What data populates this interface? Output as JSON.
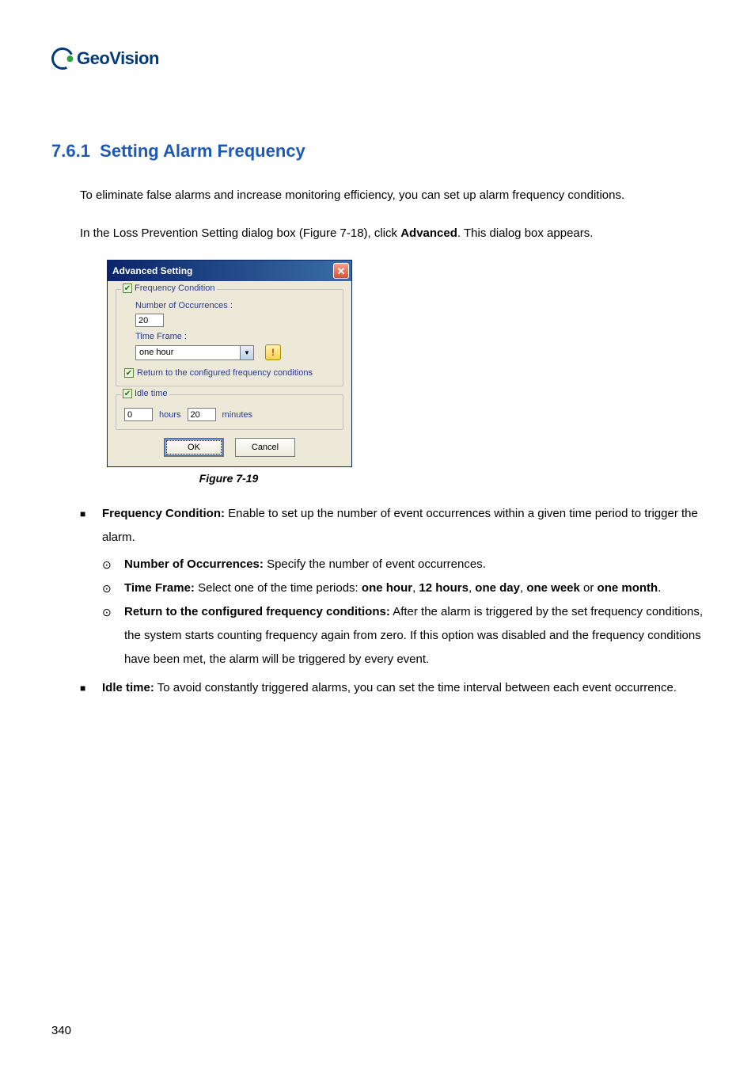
{
  "logo": {
    "brand": "GeoVision",
    "sub": ""
  },
  "heading": {
    "number": "7.6.1",
    "title": "Setting Alarm Frequency"
  },
  "paragraphs": {
    "p1": "To eliminate false alarms and increase monitoring efficiency, you can set up alarm frequency conditions.",
    "p2_a": "In the Loss Prevention Setting dialog box (Figure 7-18), click ",
    "p2_bold": "Advanced",
    "p2_b": ". This dialog box appears."
  },
  "dialog": {
    "title": "Advanced Setting",
    "close_glyph": "✕",
    "check_glyph": "✔",
    "freq": {
      "legend": "Frequency Condition",
      "num_label": "Number of Occurrences :",
      "num_value": "20",
      "timeframe_label": "Time Frame :",
      "timeframe_value": "one hour",
      "warn_glyph": "!",
      "return_label": "Return to the configured frequency conditions"
    },
    "idle": {
      "legend": "Idle time",
      "hours_value": "0",
      "hours_label": "hours",
      "minutes_value": "20",
      "minutes_label": "minutes"
    },
    "buttons": {
      "ok": "OK",
      "cancel": "Cancel"
    }
  },
  "figure_caption": "Figure 7-19",
  "bullets": {
    "b1": {
      "title": "Frequency Condition:",
      "text": "Enable to set up the number of event occurrences within a given time period to trigger the alarm.",
      "sub": [
        {
          "title": "Number of Occurrences:",
          "text": "Specify the number of event occurrences."
        },
        {
          "title": "Time Frame:",
          "text_a": " Select one of the time periods: ",
          "opt1": "one hour",
          "sep": ", ",
          "opt2": "12 hours",
          "opt3": "one day",
          "opt4": "one week",
          "or": " or ",
          "opt5": "one month",
          "period": "."
        },
        {
          "title": "Return to the configured frequency conditions:",
          "text": "After the alarm is triggered by the set frequency conditions, the system starts counting frequency again from zero. If this option was disabled and the frequency conditions have been met, the alarm will be triggered by every event."
        }
      ]
    },
    "b2": {
      "title": "Idle time:",
      "text": "To avoid constantly triggered alarms, you can set the time interval between each event occurrence."
    }
  },
  "page_number": "340"
}
